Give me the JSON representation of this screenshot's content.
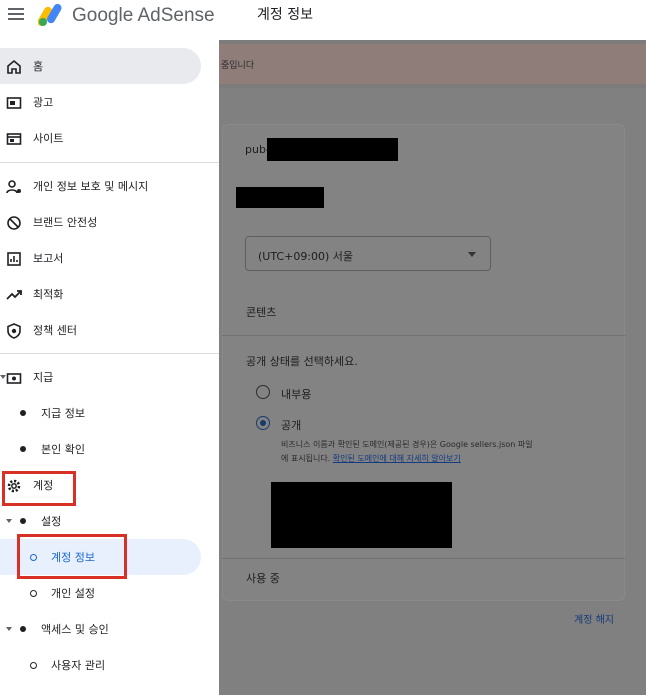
{
  "app": {
    "brand": "Google AdSense",
    "page_title": "계정 정보"
  },
  "nav": {
    "home": "홈",
    "ads": "광고",
    "sites": "사이트",
    "privacy": "개인 정보 보호 및 메시지",
    "brand_safety": "브랜드 안전성",
    "reports": "보고서",
    "optimization": "최적화",
    "policy_center": "정책 센터",
    "payments": "지급",
    "payment_info": "지급 정보",
    "verification": "본인 확인",
    "account": "계정",
    "settings": "설정",
    "account_info": "계정 정보",
    "personal_settings": "개인 설정",
    "access": "액세스 및 승인",
    "user_management": "사용자 관리"
  },
  "main": {
    "banner_text": "중입니다",
    "pub_prefix": "pub-",
    "timezone": "(UTC+09:00) 서울",
    "content_heading": "콘텐츠",
    "visibility_prompt": "공개 상태를 선택하세요.",
    "option_internal": "내부용",
    "option_public": "공개",
    "public_help_line1": "비즈니스 이름과 확인된 도메인(제공된 경우)은 Google sellers.json 파일",
    "public_help_line2_prefix": "에 표시됩니다.",
    "public_help_link": "확인된 도메인에 대해 자세히 알아보기",
    "status": "사용 중",
    "close_account": "계정 해지"
  },
  "colors": {
    "accent_blue": "#1967d2",
    "highlight_red": "#d93025"
  }
}
